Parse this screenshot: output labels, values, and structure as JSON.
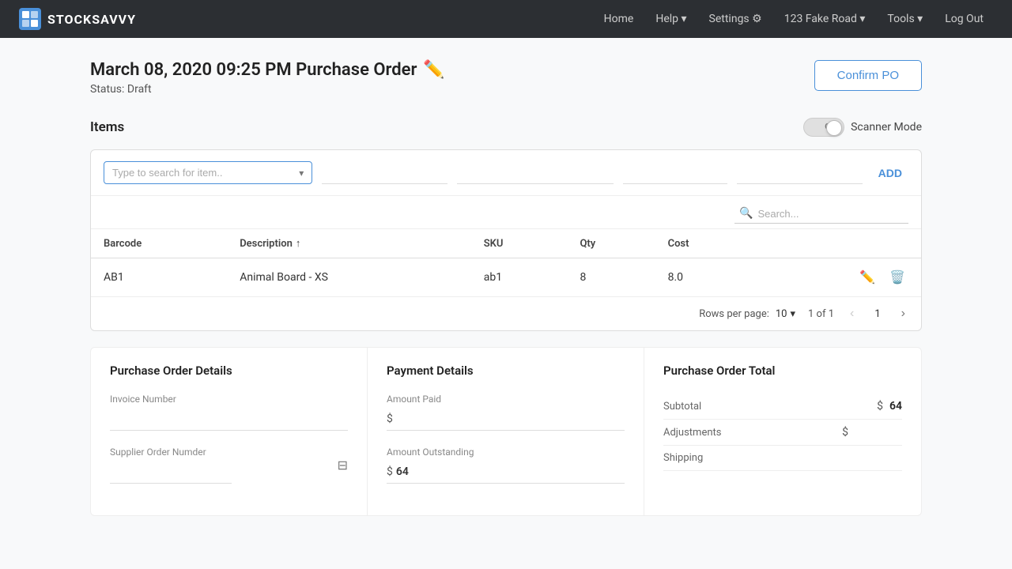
{
  "app": {
    "brand_logo_alt": "StockSavvy Logo",
    "brand_name": "STOCKSAVVY"
  },
  "navbar": {
    "links": [
      {
        "label": "Home",
        "id": "home"
      },
      {
        "label": "Help",
        "id": "help",
        "dropdown": true
      },
      {
        "label": "Settings",
        "id": "settings",
        "icon": "⚙"
      },
      {
        "label": "123 Fake Road",
        "id": "location",
        "dropdown": true
      },
      {
        "label": "Tools",
        "id": "tools",
        "dropdown": true
      },
      {
        "label": "Log Out",
        "id": "logout"
      }
    ]
  },
  "page": {
    "title": "March 08, 2020 09:25 PM Purchase Order",
    "status_label": "Status:",
    "status_value": "Draft",
    "confirm_btn_label": "Confirm PO"
  },
  "items_section": {
    "title": "Items",
    "scanner_toggle": "OFF",
    "scanner_label": "Scanner Mode"
  },
  "add_row": {
    "search_placeholder": "Type to search for item..",
    "add_label": "ADD"
  },
  "search_bar": {
    "placeholder": "Search..."
  },
  "table": {
    "columns": [
      {
        "id": "barcode",
        "label": "Barcode",
        "sortable": false
      },
      {
        "id": "description",
        "label": "Description",
        "sortable": true
      },
      {
        "id": "sku",
        "label": "SKU",
        "sortable": false
      },
      {
        "id": "qty",
        "label": "Qty",
        "sortable": false
      },
      {
        "id": "cost",
        "label": "Cost",
        "sortable": false
      }
    ],
    "rows": [
      {
        "barcode": "AB1",
        "description": "Animal Board - XS",
        "sku": "ab1",
        "qty": "8",
        "cost": "8.0"
      }
    ]
  },
  "pagination": {
    "rows_per_page_label": "Rows per page:",
    "rows_per_page_value": "10",
    "page_info": "1 of 1",
    "current_page": "1"
  },
  "po_details": {
    "title": "Purchase Order Details",
    "fields": [
      {
        "id": "invoice_number",
        "label": "Invoice Number",
        "value": ""
      },
      {
        "id": "supplier_order_number",
        "label": "Supplier Order Numder",
        "value": ""
      }
    ]
  },
  "payment_details": {
    "title": "Payment Details",
    "amount_paid_label": "Amount Paid",
    "amount_paid_symbol": "$",
    "amount_paid_value": "",
    "amount_outstanding_label": "Amount Outstanding",
    "amount_outstanding_symbol": "$",
    "amount_outstanding_value": "64"
  },
  "po_total": {
    "title": "Purchase Order Total",
    "subtotal_label": "Subtotal",
    "subtotal_symbol": "$",
    "subtotal_value": "64",
    "adjustments_label": "Adjustments",
    "adjustments_symbol": "$",
    "adjustments_value": "",
    "shipping_label": "Shipping"
  }
}
